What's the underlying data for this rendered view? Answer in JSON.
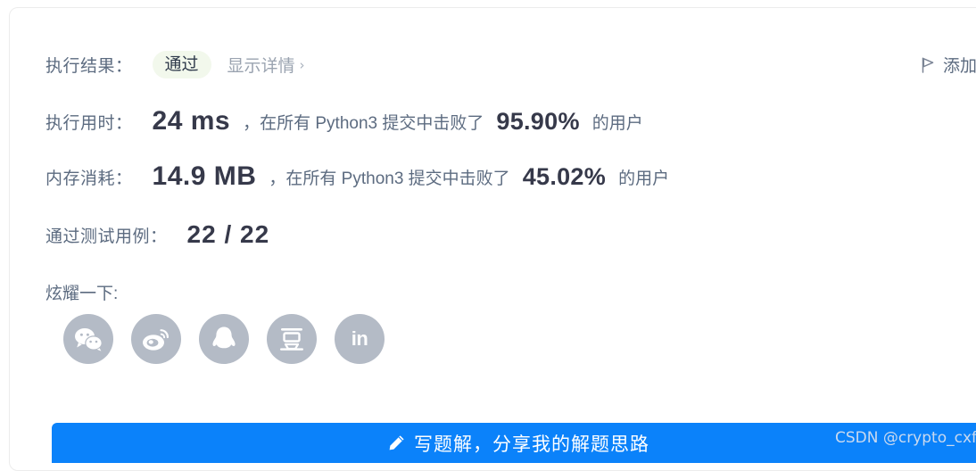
{
  "result_row": {
    "label": "执行结果：",
    "badge": "通过",
    "detail_link": "显示详情",
    "chevron": "›"
  },
  "note_action": {
    "label": "添加",
    "icon": "flag-icon"
  },
  "runtime_row": {
    "label": "执行用时：",
    "value": "24 ms",
    "middle": "，在所有 Python3 提交中击败了",
    "percent": "95.90%",
    "tail": "的用户"
  },
  "memory_row": {
    "label": "内存消耗：",
    "value": "14.9 MB",
    "middle": "，在所有 Python3 提交中击败了",
    "percent": "45.02%",
    "tail": "的用户"
  },
  "testcases_row": {
    "label": "通过测试用例：",
    "value": "22 / 22"
  },
  "share": {
    "label": "炫耀一下:",
    "items": [
      {
        "name": "wechat",
        "glyph": ""
      },
      {
        "name": "weibo",
        "glyph": ""
      },
      {
        "name": "qq",
        "glyph": ""
      },
      {
        "name": "douban",
        "glyph": "豆"
      },
      {
        "name": "linkedin",
        "glyph": "in"
      }
    ]
  },
  "write_solution_button": {
    "label": "写题解，分享我的解题思路",
    "icon": "pencil-icon",
    "color": "#0b82fa"
  },
  "watermark": "CSDN @crypto_cxf",
  "colors": {
    "badge_bg": "#f2f8ec",
    "label": "#5c6b80",
    "value": "#36394a",
    "social_bg": "#b4bbc6",
    "accent": "#0b82fa"
  }
}
